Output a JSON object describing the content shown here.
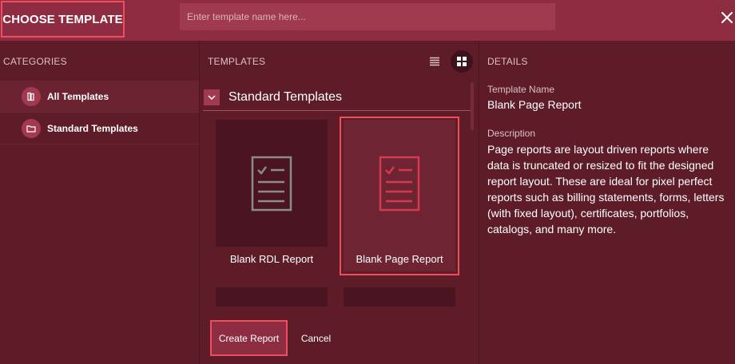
{
  "header": {
    "title": "CHOOSE TEMPLATE",
    "search_placeholder": "Enter template name here...",
    "close_glyph": "✕"
  },
  "categories": {
    "heading": "CATEGORIES",
    "items": [
      {
        "label": "All Templates",
        "icon": "book-icon",
        "active": true
      },
      {
        "label": "Standard Templates",
        "icon": "folder-icon",
        "active": false
      }
    ]
  },
  "templates": {
    "heading": "TEMPLATES",
    "view_modes": [
      {
        "name": "list-view-icon",
        "active": false
      },
      {
        "name": "grid-view-icon",
        "active": true
      }
    ],
    "group": {
      "title": "Standard Templates",
      "cards": [
        {
          "label": "Blank RDL Report",
          "selected": false
        },
        {
          "label": "Blank Page Report",
          "selected": true
        }
      ]
    },
    "create_label": "Create Report",
    "cancel_label": "Cancel"
  },
  "details": {
    "heading": "DETAILS",
    "name_label": "Template Name",
    "name_value": "Blank Page Report",
    "desc_label": "Description",
    "desc_value": "Page reports are layout driven reports where data is truncated or resized to fit the designed report layout. These are ideal for pixel perfect reports such as billing statements, forms, letters (with fixed layout), certificates, portfolios, catalogs, and many more."
  },
  "colors": {
    "background": "#5e1c29",
    "header": "#8e2d41",
    "accent_border": "#f04e5d",
    "icon_grey": "#8c8c8c",
    "icon_red": "#d33a4f"
  }
}
